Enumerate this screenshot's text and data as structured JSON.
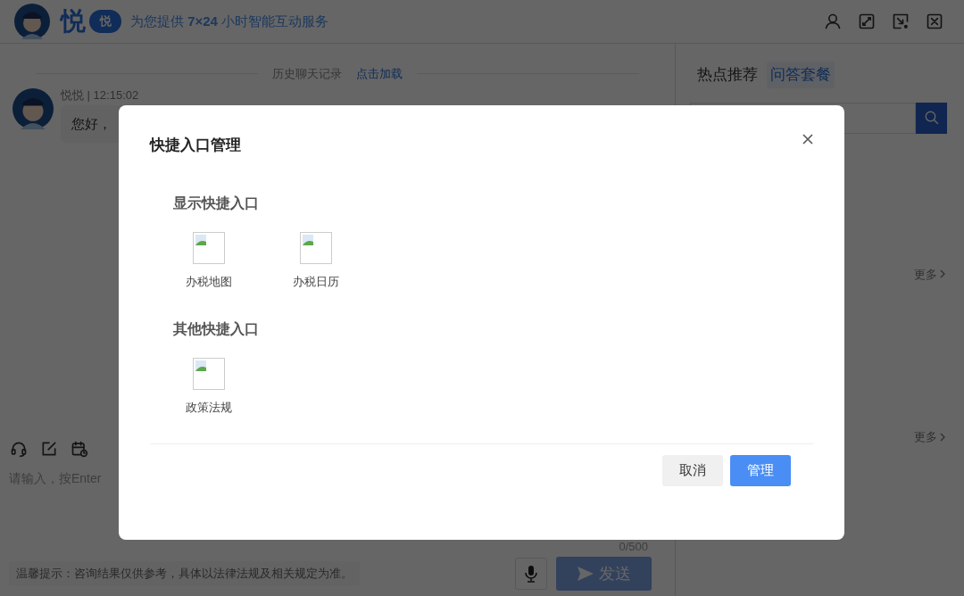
{
  "header": {
    "logo_text": "悦",
    "logo_badge": "悦",
    "tagline": "为您提供 **7×24** 小时智能互动服务"
  },
  "chat": {
    "history_label": "历史聊天记录",
    "history_link": "点击加载",
    "messages": [
      {
        "meta": "悦悦 | 12:15:02",
        "text": "您好，"
      }
    ],
    "composer": {
      "placeholder": "请输入，按Enter",
      "counter": "0/500",
      "tip": "温馨提示：咨询结果仅供参考，具体以法律法规及相关规定为准。",
      "send_label": "发送",
      "send_disabled": true
    }
  },
  "side_panel": {
    "tabs": [
      {
        "label": "热点推荐",
        "selected": false
      },
      {
        "label": "问答套餐",
        "selected": true
      }
    ],
    "more_links": [
      "更多",
      "更多"
    ]
  },
  "dialog": {
    "title": "快捷入口管理",
    "sections": [
      {
        "heading": "显示快捷入口",
        "items": [
          {
            "label": "办税地图"
          },
          {
            "label": "办税日历"
          }
        ]
      },
      {
        "heading": "其他快捷入口",
        "items": [
          {
            "label": "政策法规"
          }
        ]
      }
    ],
    "buttons": [
      {
        "label": "取消",
        "kind": "secondary"
      },
      {
        "label": "管理",
        "kind": "primary"
      }
    ]
  }
}
